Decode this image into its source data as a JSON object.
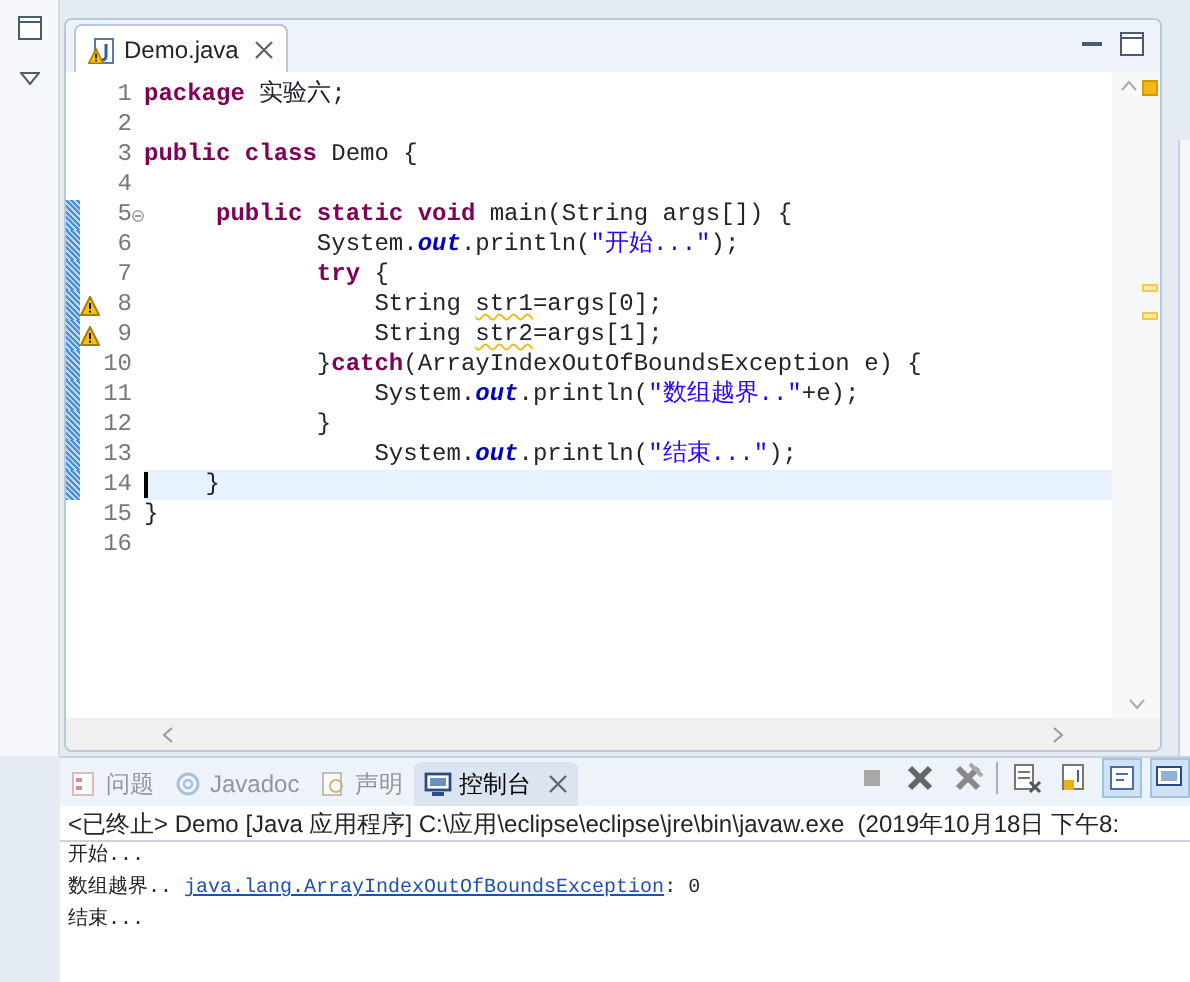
{
  "editor": {
    "tabs": [
      {
        "label": "Demo.java",
        "selected": true,
        "warning": true
      }
    ],
    "lines": [
      {
        "number": "1",
        "changed": false,
        "warning": false,
        "fold": false,
        "current": false,
        "segments": [
          {
            "kind": "kw",
            "t": "package"
          },
          {
            "kind": "plain",
            "t": " 实验六;"
          }
        ]
      },
      {
        "number": "2",
        "changed": false,
        "warning": false,
        "fold": false,
        "current": false
      },
      {
        "number": "3",
        "changed": false,
        "warning": false,
        "fold": false,
        "current": false,
        "segments": [
          {
            "kind": "kw",
            "t": "public"
          },
          {
            "kind": "kw",
            "t": " class"
          },
          {
            "kind": "plain",
            "t": " Demo {"
          }
        ]
      },
      {
        "number": "4",
        "changed": false,
        "warning": false,
        "fold": false,
        "current": false
      },
      {
        "number": "5",
        "changed": true,
        "warning": false,
        "fold": true,
        "current": false,
        "segments": [
          {
            "kind": "kw",
            "t": "     public"
          },
          {
            "kind": "kw",
            "t": " static"
          },
          {
            "kind": "kw",
            "t": " void"
          },
          {
            "kind": "plain",
            "t": " main(String args[]) {"
          }
        ]
      },
      {
        "number": "6",
        "changed": true,
        "warning": false,
        "fold": false,
        "current": false,
        "segments": [
          {
            "kind": "plain",
            "t": "            System."
          },
          {
            "kind": "field",
            "t": "out"
          },
          {
            "kind": "plain",
            "t": ".println("
          },
          {
            "kind": "str",
            "t": "\"开始...\""
          },
          {
            "kind": "plain",
            "t": ");"
          }
        ]
      },
      {
        "number": "7",
        "changed": true,
        "warning": false,
        "fold": false,
        "current": false,
        "segments": [
          {
            "kind": "kw",
            "t": "            try"
          },
          {
            "kind": "plain",
            "t": " {"
          }
        ]
      },
      {
        "number": "8",
        "changed": true,
        "warning": true,
        "fold": false,
        "current": false,
        "segments": [
          {
            "kind": "plain",
            "t": "                String "
          },
          {
            "kind": "warn",
            "t": "str1"
          },
          {
            "kind": "plain",
            "t": "=args[0];"
          }
        ]
      },
      {
        "number": "9",
        "changed": true,
        "warning": true,
        "fold": false,
        "current": false,
        "segments": [
          {
            "kind": "plain",
            "t": "                String "
          },
          {
            "kind": "warn",
            "t": "str2"
          },
          {
            "kind": "plain",
            "t": "=args[1];"
          }
        ]
      },
      {
        "number": "10",
        "changed": true,
        "warning": false,
        "fold": false,
        "current": false,
        "segments": [
          {
            "kind": "plain",
            "t": "            }"
          },
          {
            "kind": "kw",
            "t": "catch"
          },
          {
            "kind": "plain",
            "t": "(ArrayIndexOutOfBoundsException e) {"
          }
        ]
      },
      {
        "number": "11",
        "changed": true,
        "warning": false,
        "fold": false,
        "current": false,
        "segments": [
          {
            "kind": "plain",
            "t": "                System."
          },
          {
            "kind": "field",
            "t": "out"
          },
          {
            "kind": "plain",
            "t": ".println("
          },
          {
            "kind": "str",
            "t": "\"数组越界..\""
          },
          {
            "kind": "plain",
            "t": "+e);"
          }
        ]
      },
      {
        "number": "12",
        "changed": true,
        "warning": false,
        "fold": false,
        "current": false,
        "segments": [
          {
            "kind": "plain",
            "t": "            }"
          }
        ]
      },
      {
        "number": "13",
        "changed": true,
        "warning": false,
        "fold": false,
        "current": false,
        "segments": [
          {
            "kind": "plain",
            "t": "                System."
          },
          {
            "kind": "field",
            "t": "out"
          },
          {
            "kind": "plain",
            "t": ".println("
          },
          {
            "kind": "str",
            "t": "\"结束...\""
          },
          {
            "kind": "plain",
            "t": ");"
          }
        ]
      },
      {
        "number": "14",
        "changed": true,
        "warning": false,
        "fold": false,
        "current": true,
        "segments": [
          {
            "kind": "plain",
            "t": "    }"
          }
        ]
      },
      {
        "number": "15",
        "changed": false,
        "warning": false,
        "fold": false,
        "current": false,
        "segments": [
          {
            "kind": "plain",
            "t": "}"
          }
        ]
      },
      {
        "number": "16",
        "changed": false,
        "warning": false,
        "fold": false,
        "current": false
      }
    ]
  },
  "console": {
    "tabs": [
      {
        "label": "问题",
        "selected": false,
        "kind": "problems"
      },
      {
        "label": "Javadoc",
        "selected": false,
        "kind": "javadoc"
      },
      {
        "label": "声明",
        "selected": false,
        "kind": "declaration"
      },
      {
        "label": "控制台",
        "selected": true,
        "kind": "console"
      }
    ],
    "header": "<已终止> Demo [Java 应用程序] C:\\应用\\eclipse\\eclipse\\jre\\bin\\javaw.exe  (2019年10月18日 下午8:",
    "output": [
      [
        {
          "kind": "text",
          "t": "开始..."
        }
      ],
      [
        {
          "kind": "text",
          "t": "数组越界.. "
        },
        {
          "kind": "link",
          "t": "java.lang.ArrayIndexOutOfBoundsException"
        },
        {
          "kind": "text",
          "t": ": 0"
        }
      ],
      [
        {
          "kind": "text",
          "t": "结束..."
        }
      ]
    ]
  }
}
